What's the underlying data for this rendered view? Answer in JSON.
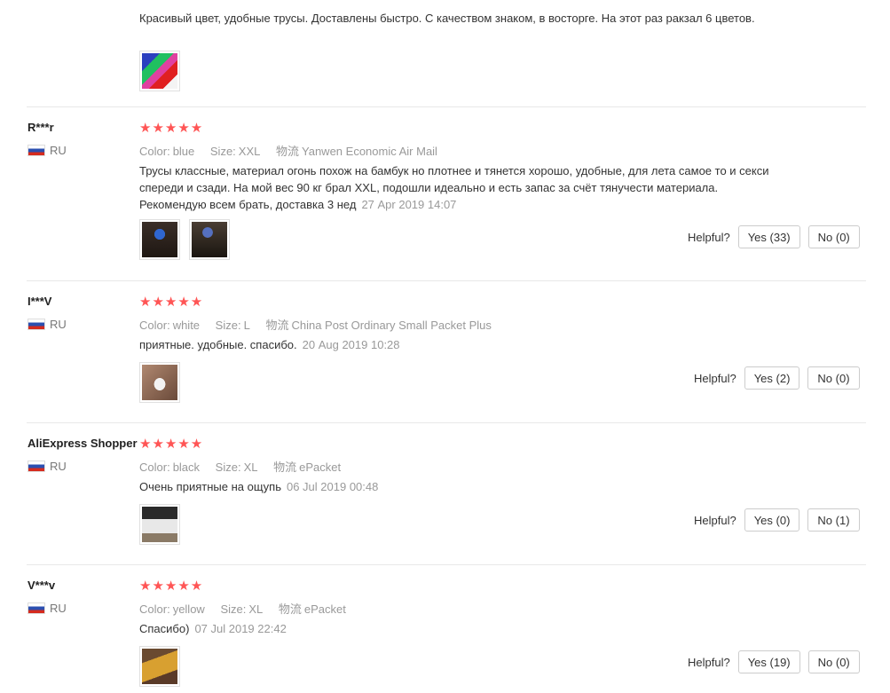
{
  "labels": {
    "color": "Color:",
    "size": "Size:",
    "shipping": "物流",
    "helpful": "Helpful?"
  },
  "top_review": {
    "text": "Красивый цвет, удобные трусы. Доставлены быстро. С качеством знаком, в восторге. На этот раз ракзал 6 цветов.",
    "photo_icon": "photo-thumbnail"
  },
  "reviews": [
    {
      "author": "R***r",
      "country": "RU",
      "stars": "★★★★★",
      "color": "blue",
      "size": "XXL",
      "shipping": "Yanwen Economic Air Mail",
      "text": "Трусы классные, материал огонь похож на бамбук но плотнее и тянется хорошо, удобные, для лета самое то и секси спереди и сзади. На мой вес 90 кг брал XXL, подошли идеально и есть запас за счёт тянучести материала. Рекомендую всем брать, доставка 3 нед",
      "date": "27 Apr 2019 14:07",
      "yes": "Yes (33)",
      "no": "No (0)"
    },
    {
      "author": "I***V",
      "country": "RU",
      "stars": "★★★★★",
      "color": "white",
      "size": "L",
      "shipping": "China Post Ordinary Small Packet Plus",
      "text": "приятные. удобные. спасибо.",
      "date": "20 Aug 2019 10:28",
      "yes": "Yes (2)",
      "no": "No (0)"
    },
    {
      "author": "AliExpress Shopper",
      "country": "RU",
      "stars": "★★★★★",
      "color": "black",
      "size": "XL",
      "shipping": "ePacket",
      "text": "Очень приятные на ощупь",
      "date": "06 Jul 2019 00:48",
      "yes": "Yes (0)",
      "no": "No (1)"
    },
    {
      "author": "V***v",
      "country": "RU",
      "stars": "★★★★★",
      "color": "yellow",
      "size": "XL",
      "shipping": "ePacket",
      "text": "Спасибо)",
      "date": "07 Jul 2019 22:42",
      "yes": "Yes (19)",
      "no": "No (0)"
    }
  ],
  "colors": {
    "star": "#ff5555",
    "muted": "#999999",
    "text": "#333333"
  }
}
